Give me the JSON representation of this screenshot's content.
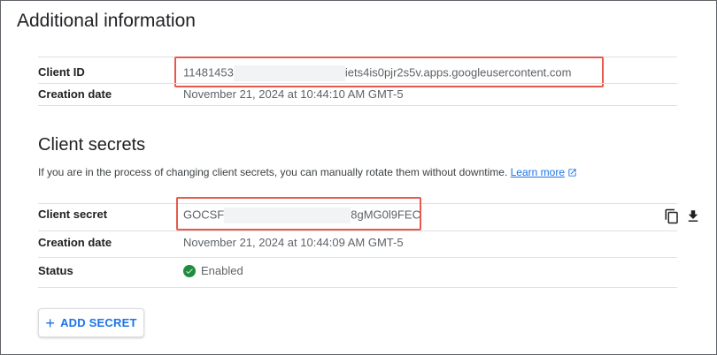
{
  "page": {
    "title": "Additional information"
  },
  "oauth_client": {
    "client_id_label": "Client ID",
    "client_id_prefix": "11481453",
    "client_id_suffix": "iets4is0pjr2s5v.apps.googleusercontent.com",
    "creation_label": "Creation date",
    "creation_value": "November 21, 2024 at 10:44:10 AM GMT-5"
  },
  "secrets": {
    "title": "Client secrets",
    "description": "If you are in the process of changing client secrets, you can manually rotate them without downtime.",
    "learn_more": "Learn more",
    "secret_label": "Client secret",
    "secret_prefix": "GOCSF",
    "secret_suffix": "8gMG0l9FEC",
    "creation_label": "Creation date",
    "creation_value": "November 21, 2024 at 10:44:09 AM GMT-5",
    "status_label": "Status",
    "status_value": "Enabled",
    "copy_icon": "copy-icon",
    "download_icon": "download-icon"
  },
  "actions": {
    "add_secret": "ADD SECRET"
  },
  "colors": {
    "accent": "#1a73e8",
    "highlight": "#e8594d",
    "status_enabled": "#1e8e3e"
  }
}
